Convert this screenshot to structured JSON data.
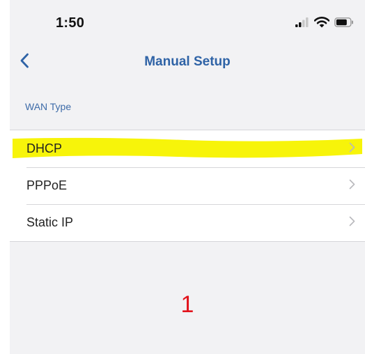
{
  "status_bar": {
    "time": "1:50",
    "icons": [
      "signal-icon",
      "wifi-icon",
      "battery-icon"
    ]
  },
  "nav": {
    "back_icon": "chevron-left-icon",
    "title": "Manual Setup"
  },
  "section": {
    "header": "WAN Type"
  },
  "wan_types": [
    {
      "label": "DHCP",
      "highlighted": true
    },
    {
      "label": "PPPoE",
      "highlighted": false
    },
    {
      "label": "Static IP",
      "highlighted": false
    }
  ],
  "annotation": {
    "number": "1"
  },
  "colors": {
    "accent": "#2f63a6",
    "highlight": "#f7f40a",
    "annotation": "#e2141c",
    "background": "#f2f2f4"
  }
}
